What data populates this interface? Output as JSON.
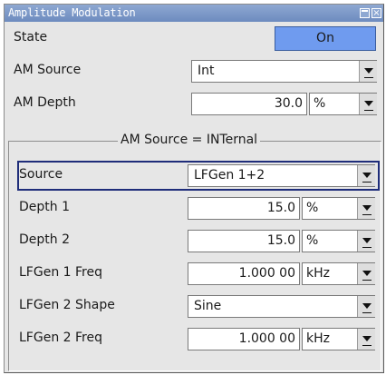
{
  "window": {
    "title": "Amplitude Modulation"
  },
  "state": {
    "label": "State",
    "value": "On"
  },
  "am_source": {
    "label": "AM Source",
    "value": "Int"
  },
  "am_depth": {
    "label": "AM Depth",
    "value": "30.0",
    "unit": "%"
  },
  "group": {
    "title": "AM Source = INTernal"
  },
  "source": {
    "label": "Source",
    "value": "LFGen 1+2"
  },
  "depth1": {
    "label": "Depth 1",
    "value": "15.0",
    "unit": "%"
  },
  "depth2": {
    "label": "Depth 2",
    "value": "15.0",
    "unit": "%"
  },
  "lfgen1_freq": {
    "label": "LFGen 1 Freq",
    "value": "1.000 00",
    "unit": "kHz"
  },
  "lfgen2_shape": {
    "label": "LFGen 2 Shape",
    "value": "Sine"
  },
  "lfgen2_freq": {
    "label": "LFGen 2 Freq",
    "value": "1.000 00",
    "unit": "kHz"
  },
  "colors": {
    "titlebar": "#7f9ac8",
    "on_button": "#6f9bef",
    "highlight": "#1f2d7a",
    "panel": "#e6e6e6"
  },
  "icons": {
    "maximize": "maximize-icon",
    "close": "close-icon",
    "dropdown": "chevron-down-icon"
  }
}
